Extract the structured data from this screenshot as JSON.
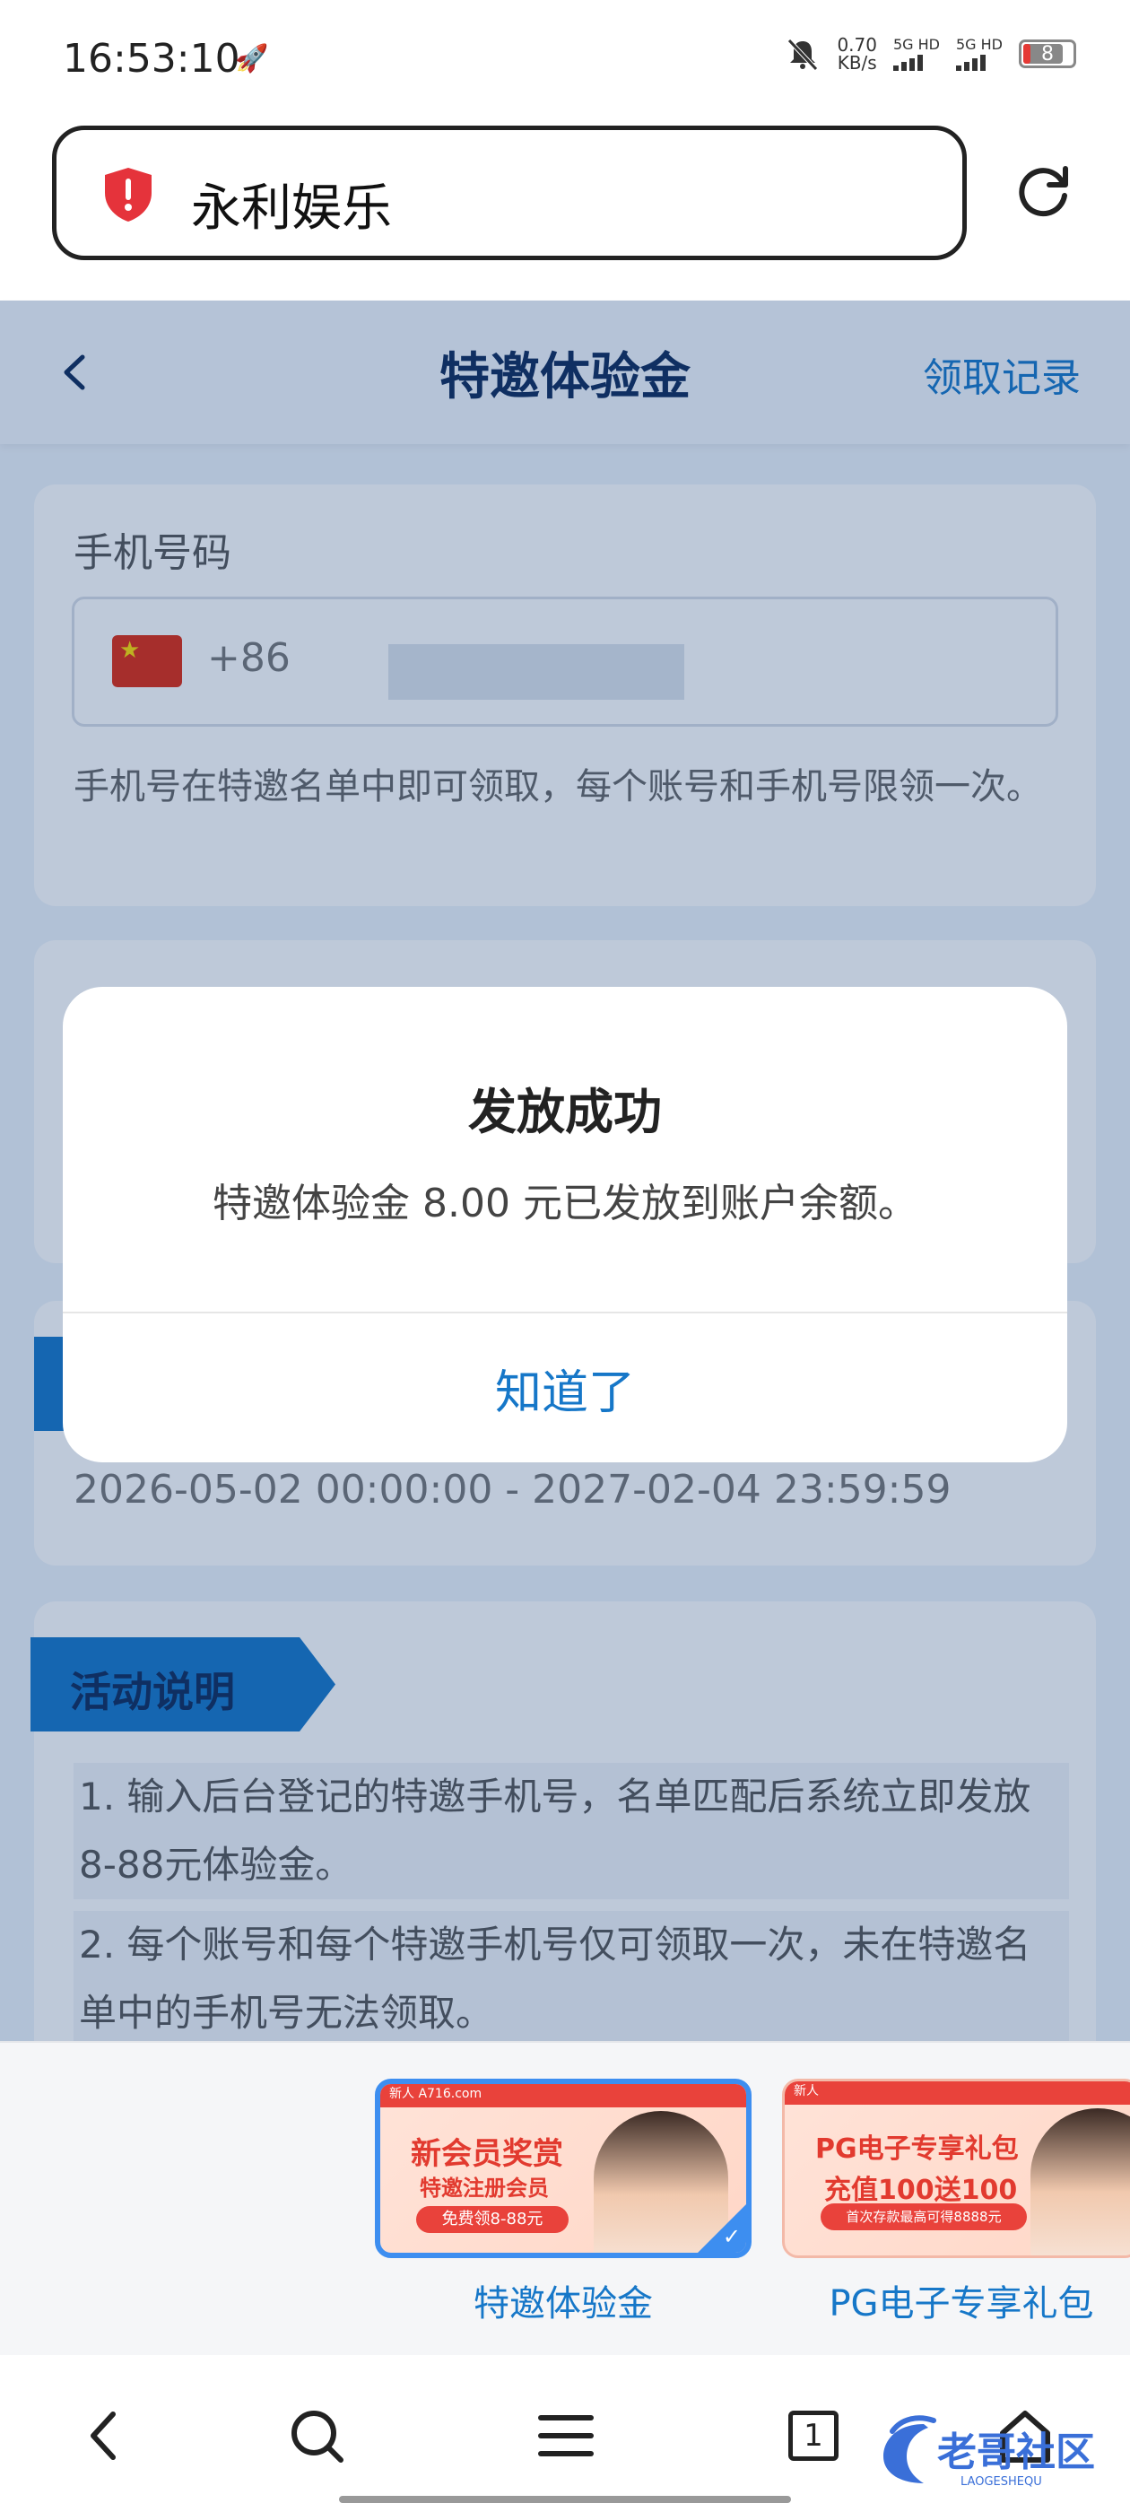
{
  "status_bar": {
    "time": "16:53:10",
    "net_speed_value": "0.70",
    "net_speed_unit": "KB/s",
    "sim1": "5G HD",
    "sim2": "5G HD",
    "battery": "8"
  },
  "browser": {
    "address_text": "永利娱乐",
    "tab_count": "1"
  },
  "page": {
    "title": "特邀体验金",
    "records_link": "领取记录",
    "phone_label": "手机号码",
    "country_code": "+86",
    "phone_hint": "手机号在特邀名单中即可领取，每个账号和手机号限领一次。",
    "period": "2026-05-02 00:00:00 - 2027-02-04 23:59:59",
    "rules_title": "活动说明",
    "rules": [
      "1. 输入后台登记的特邀手机号，名单匹配后系统立即发放8-88元体验金。",
      "2. 每个账号和每个特邀手机号仅可领取一次，未在特邀名单中的手机号无法领取。"
    ]
  },
  "dialog": {
    "title": "发放成功",
    "message": "特邀体验金 8.00 元已发放到账户余额。",
    "ok_button": "知道了"
  },
  "tabs": [
    {
      "label": "特邀体验金",
      "thumb_badge": "新人 A716.com",
      "thumb_title": "新会员奖赏",
      "thumb_subtitle": "特邀注册会员",
      "thumb_pill": "免费领8-88元"
    },
    {
      "label": "PG电子专享礼包",
      "thumb_badge": "新人",
      "thumb_title": "PG电子专享礼包",
      "thumb_subtitle": "充值100送100",
      "thumb_pill": "首次存款最高可得8888元"
    }
  ],
  "watermark": {
    "text": "老哥社区",
    "subtext": "LAOGESHEQU"
  },
  "colors": {
    "accent": "#1677c8",
    "title_navy": "#0d2a5a",
    "alert_red": "#e53935"
  },
  "icons": [
    "rocket-icon",
    "mute-icon",
    "shield-alert-icon",
    "reload-icon",
    "chevron-left-icon",
    "search-icon",
    "menu-icon",
    "home-icon"
  ]
}
